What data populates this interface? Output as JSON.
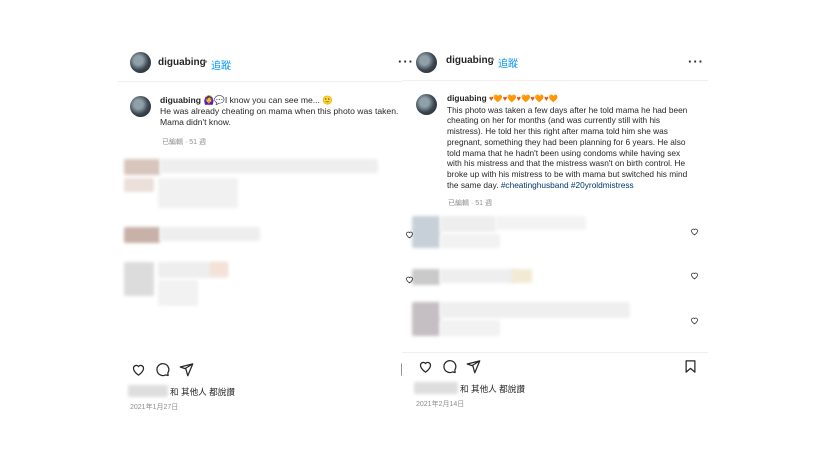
{
  "left_post": {
    "username": "diguabing",
    "follow_label": "追蹤",
    "more_icon": "more-options-icon",
    "caption_emojis_after_name": "🙆‍♀️💬",
    "caption_text": "I know you can see me... 🙂 He was already cheating on mama when this photo was taken. Mama didn't know.",
    "caption_line1": "I know you can see me... ",
    "caption_line2": "He was already cheating on mama when this photo was taken.",
    "caption_line3": "Mama didn't know.",
    "caption_meta": "已編輯 · 51 週",
    "liked_by_text": "和 其他人 都說讚",
    "date": "2021年1月27日"
  },
  "right_post": {
    "username": "diguabing",
    "follow_label": "追蹤",
    "caption_name_emojis": "♥🧡♥🧡♥🧡♥🧡♥🧡",
    "caption_lines": [
      "This photo was taken a few days after he told mama he had been",
      "cheating on her for months (and was currently still with his",
      "mistress). He told her this right after mama told him she was",
      "pregnant, something they had been planning for 6 years. He also",
      "told mama that he hadn't been using condoms while having sex",
      "with his mistress and that the mistress wasn't on birth control. He",
      "broke up with his mistress to be with mama but switched his mind",
      "the same day."
    ],
    "hashtags": "#cheatinghusband #20yroldmistress",
    "caption_meta": "已編輯 · 51 週",
    "liked_by_text": "和 其他人 都說讚",
    "date": "2021年2月14日"
  },
  "colors": {
    "link_blue": "#0095f6",
    "hashtag_blue": "#00376b",
    "meta_gray": "#8e8e8e",
    "text": "#262626"
  },
  "icons": [
    "heart-icon",
    "comment-icon",
    "share-icon",
    "bookmark-icon",
    "more-options-icon"
  ]
}
